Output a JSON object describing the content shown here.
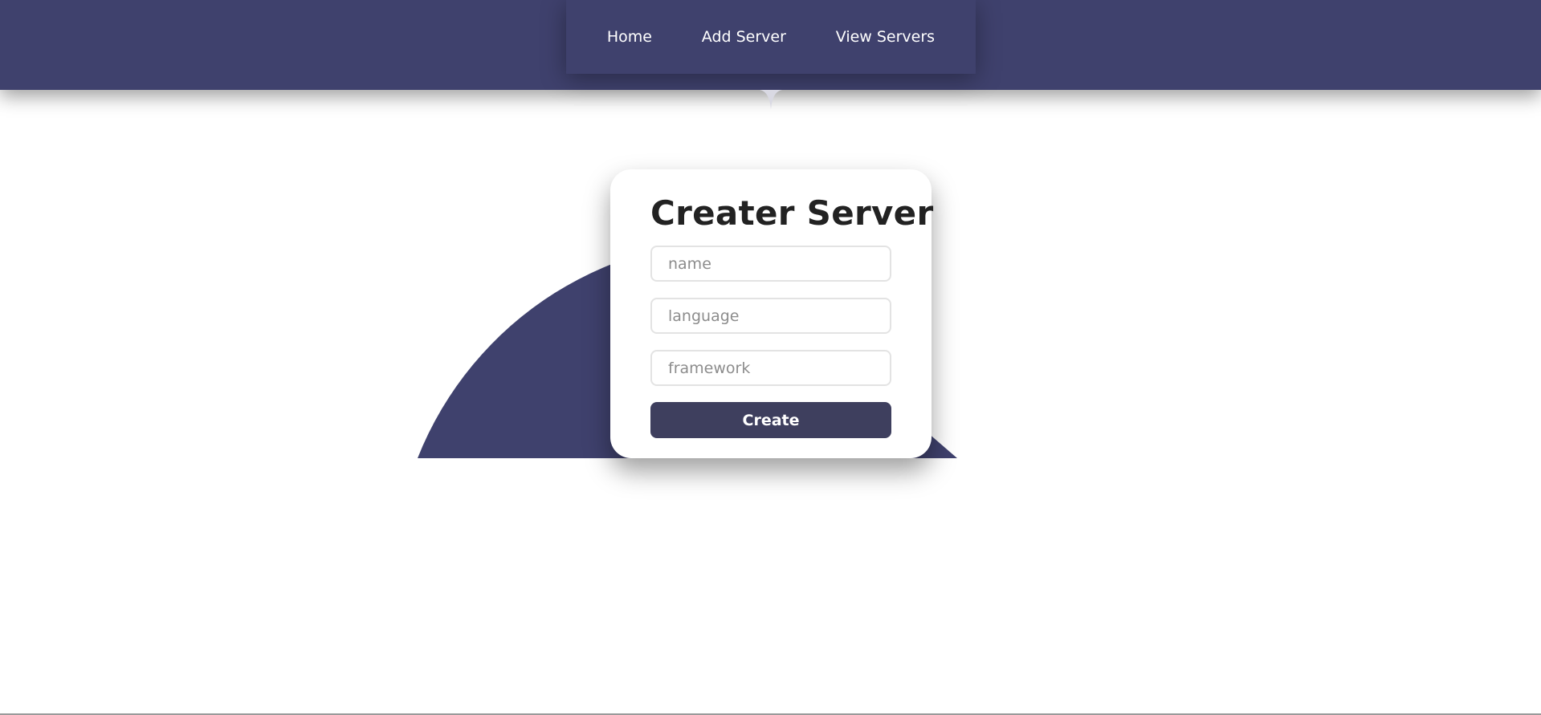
{
  "colors": {
    "brand": "#3f416d",
    "button": "#3e3f5e",
    "title": "#222222",
    "placeholder": "#8c8c8c"
  },
  "nav": {
    "items": [
      {
        "label": "Home"
      },
      {
        "label": "Add Server"
      },
      {
        "label": "View Servers"
      }
    ]
  },
  "form": {
    "title": "Creater Server",
    "fields": [
      {
        "placeholder": "name"
      },
      {
        "placeholder": "language"
      },
      {
        "placeholder": "framework"
      }
    ],
    "submit_label": "Create"
  }
}
